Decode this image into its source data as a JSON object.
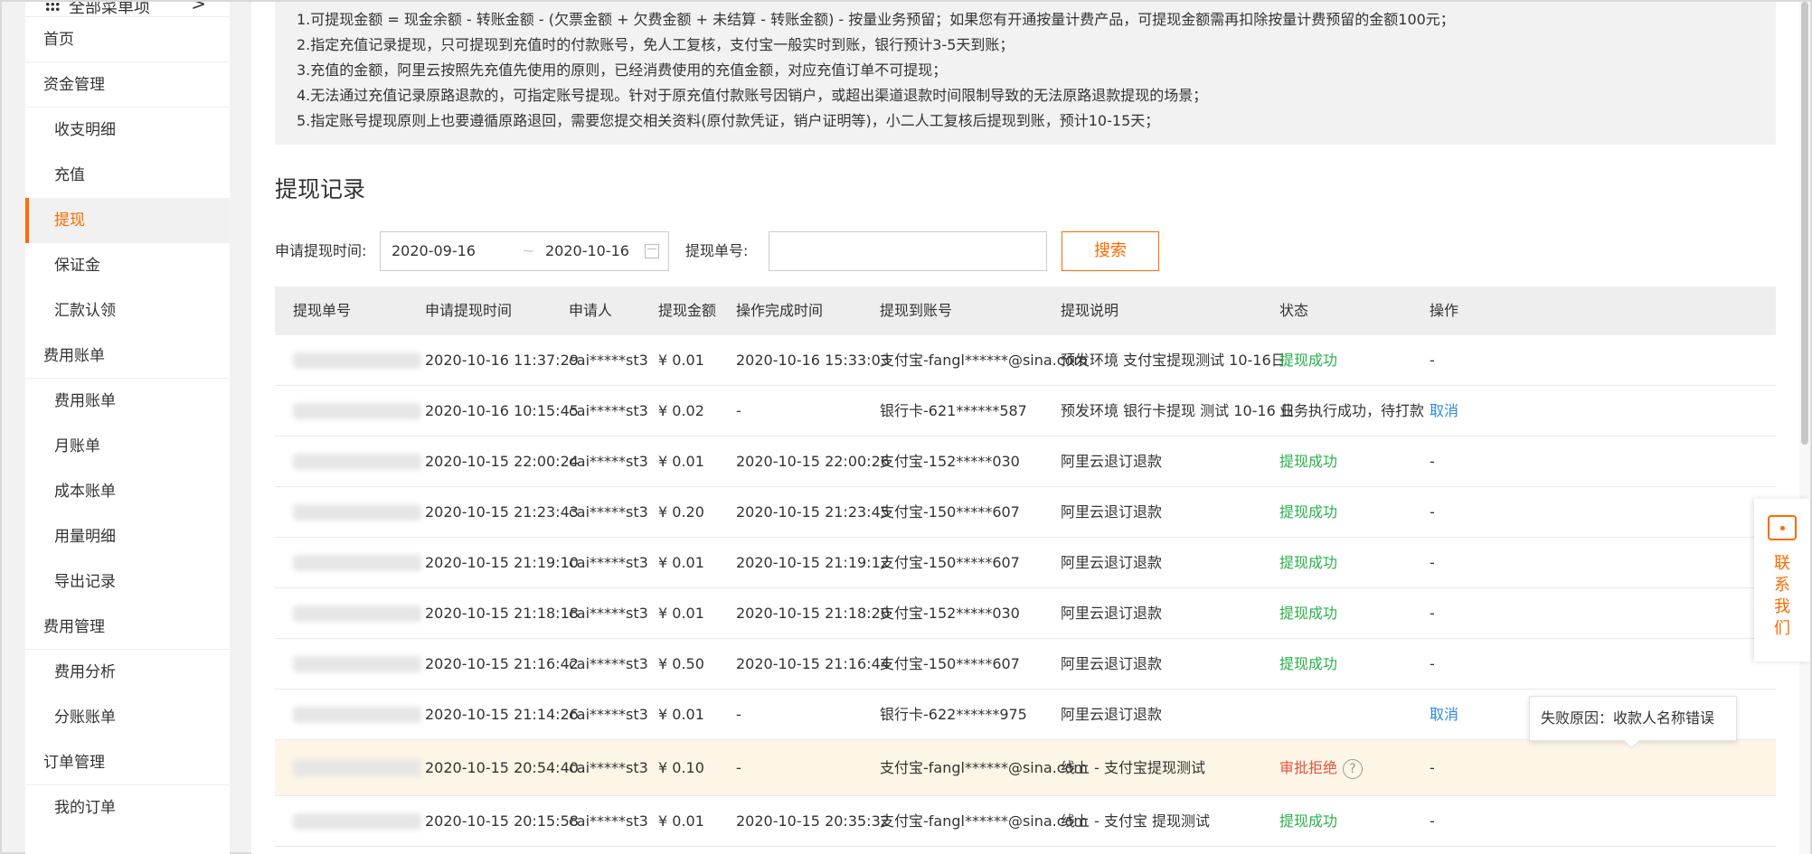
{
  "sidebar": {
    "all_menu": "全部菜单项",
    "chevron": ">",
    "items": [
      {
        "label": "首页",
        "kind": "group"
      },
      {
        "label": "资金管理",
        "kind": "group"
      },
      {
        "label": "收支明细",
        "kind": "sub"
      },
      {
        "label": "充值",
        "kind": "sub"
      },
      {
        "label": "提现",
        "kind": "sub",
        "active": true
      },
      {
        "label": "保证金",
        "kind": "sub"
      },
      {
        "label": "汇款认领",
        "kind": "sub"
      },
      {
        "label": "费用账单",
        "kind": "group"
      },
      {
        "label": "费用账单",
        "kind": "sub"
      },
      {
        "label": "月账单",
        "kind": "sub"
      },
      {
        "label": "成本账单",
        "kind": "sub"
      },
      {
        "label": "用量明细",
        "kind": "sub"
      },
      {
        "label": "导出记录",
        "kind": "sub"
      },
      {
        "label": "费用管理",
        "kind": "group"
      },
      {
        "label": "费用分析",
        "kind": "sub"
      },
      {
        "label": "分账账单",
        "kind": "sub"
      },
      {
        "label": "订单管理",
        "kind": "group"
      },
      {
        "label": "我的订单",
        "kind": "sub"
      }
    ]
  },
  "notice": {
    "lines": [
      "1.可提现金额 = 现金余额 - 转账金额 - (欠票金额 + 欠费金额 + 未结算 - 转账金额) - 按量业务预留；如果您有开通按量计费产品，可提现金额需再扣除按量计费预留的金额100元；",
      "2.指定充值记录提现，只可提现到充值时的付款账号，免人工复核，支付宝一般实时到账，银行预计3-5天到账；",
      "3.充值的金额，阿里云按照先充值先使用的原则，已经消费使用的充值金额，对应充值订单不可提现；",
      "4.无法通过充值记录原路退款的，可指定账号提现。针对于原充值付款账号因销户，或超出渠道退款时间限制导致的无法原路退款提现的场景；",
      "5.指定账号提现原则上也要遵循原路退回，需要您提交相关资料(原付款凭证，销户证明等)，小二人工复核后提现到账，预计10-15天；"
    ]
  },
  "section_title": "提现记录",
  "filters": {
    "date_label": "申请提现时间:",
    "date_start": "2020-09-16",
    "date_sep": "~",
    "date_end": "2020-10-16",
    "no_label": "提现单号:",
    "no_value": "",
    "search_label": "搜索"
  },
  "table": {
    "headers": [
      "提现单号",
      "申请提现时间",
      "申请人",
      "提现金额",
      "操作完成时间",
      "提现到账号",
      "提现说明",
      "状态",
      "操作"
    ],
    "rows": [
      {
        "time": "2020-10-16 11:37:29",
        "user": "cai*****st3",
        "amount": "¥ 0.01",
        "done": "2020-10-16 15:33:03",
        "account": "支付宝-fangl******@sina.com",
        "desc": "预发环境 支付宝提现测试 10-16日",
        "status": "提现成功",
        "status_type": "ok",
        "op": "-"
      },
      {
        "time": "2020-10-16 10:15:45",
        "user": "cai*****st3",
        "amount": "¥ 0.02",
        "done": "-",
        "account": "银行卡-621******587",
        "desc": "预发环境 银行卡提现 测试 10-16 日",
        "status": "业务执行成功，待打款",
        "status_type": "plain",
        "op": "取消"
      },
      {
        "time": "2020-10-15 22:00:24",
        "user": "cai*****st3",
        "amount": "¥ 0.01",
        "done": "2020-10-15 22:00:26",
        "account": "支付宝-152*****030",
        "desc": "阿里云退订退款",
        "status": "提现成功",
        "status_type": "ok",
        "op": "-"
      },
      {
        "time": "2020-10-15 21:23:43",
        "user": "cai*****st3",
        "amount": "¥ 0.20",
        "done": "2020-10-15 21:23:45",
        "account": "支付宝-150*****607",
        "desc": "阿里云退订退款",
        "status": "提现成功",
        "status_type": "ok",
        "op": "-"
      },
      {
        "time": "2020-10-15 21:19:10",
        "user": "cai*****st3",
        "amount": "¥ 0.01",
        "done": "2020-10-15 21:19:12",
        "account": "支付宝-150*****607",
        "desc": "阿里云退订退款",
        "status": "提现成功",
        "status_type": "ok",
        "op": "-"
      },
      {
        "time": "2020-10-15 21:18:18",
        "user": "cai*****st3",
        "amount": "¥ 0.01",
        "done": "2020-10-15 21:18:20",
        "account": "支付宝-152*****030",
        "desc": "阿里云退订退款",
        "status": "提现成功",
        "status_type": "ok",
        "op": "-"
      },
      {
        "time": "2020-10-15 21:16:42",
        "user": "cai*****st3",
        "amount": "¥ 0.50",
        "done": "2020-10-15 21:16:44",
        "account": "支付宝-150*****607",
        "desc": "阿里云退订退款",
        "status": "提现成功",
        "status_type": "ok",
        "op": "-"
      },
      {
        "time": "2020-10-15 21:14:26",
        "user": "cai*****st3",
        "amount": "¥ 0.01",
        "done": "-",
        "account": "银行卡-622******975",
        "desc": "阿里云退订退款",
        "status": "",
        "status_type": "plain",
        "op": "取消"
      },
      {
        "time": "2020-10-15 20:54:40",
        "user": "cai*****st3",
        "amount": "¥ 0.10",
        "done": "-",
        "account": "支付宝-fangl******@sina.com",
        "desc": "线上 - 支付宝提现测试",
        "status": "审批拒绝",
        "status_type": "reject",
        "op": "-"
      },
      {
        "time": "2020-10-15 20:15:58",
        "user": "cai*****st3",
        "amount": "¥ 0.01",
        "done": "2020-10-15 20:35:32",
        "account": "支付宝-fangl******@sina.com",
        "desc": "线上 - 支付宝 提现测试",
        "status": "提现成功",
        "status_type": "ok",
        "op": "-"
      }
    ]
  },
  "tooltip": {
    "text": "失败原因：收款人名称错误"
  },
  "contact": {
    "chars": [
      "联",
      "系",
      "我",
      "们"
    ]
  },
  "colors": {
    "accent": "#ff6a00",
    "success": "#27b148",
    "reject": "#e5533d",
    "link": "#2b8ae6"
  }
}
